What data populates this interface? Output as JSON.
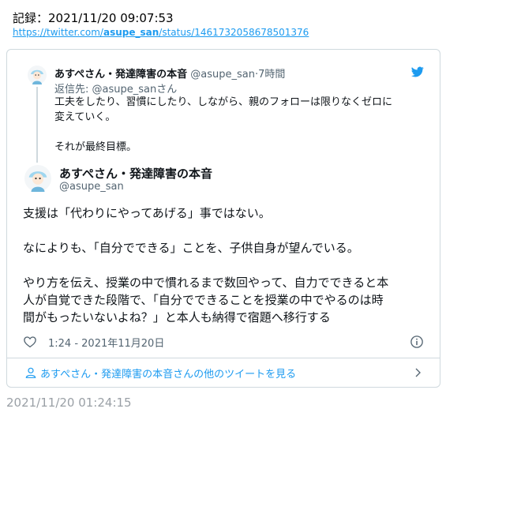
{
  "record": {
    "text": "記録：2021/11/20 09:07:53"
  },
  "source_link": {
    "prefix": "https://twitter.com/",
    "user": "asupe_san",
    "suffix": "/status/1461732058678501376"
  },
  "parent_tweet": {
    "name": "あすぺさん・発達障害の本音",
    "handle": "@asupe_san",
    "separator": "·",
    "time": "7時間",
    "reply_to": "返信先: @asupe_sanさん",
    "text": "工夫をしたり、習慣にしたり、しながら、親のフォローは限りなくゼロに\n変えていく。\n\nそれが最終目標。"
  },
  "main_tweet": {
    "name": "あすぺさん・発達障害の本音",
    "handle": "@asupe_san",
    "text": "支援は「代わりにやってあげる」事ではない。\n\nなによりも、「自分でできる」ことを、子供自身が望んでいる。\n\nやり方を伝え、授業の中で慣れるまで数回やって、自力でできると本\n人が自覚できた段階で、「自分でできることを授業の中でやるのは時\n間がもったいないよね？」と本人も納得で宿題へ移行する",
    "timestamp": "1:24 - 2021年11月20日"
  },
  "more_link": {
    "label": "あすぺさん・発達障害の本音さんの他のツイートを見る"
  },
  "footer": {
    "time": "2021/11/20 01:24:15"
  },
  "icons": [
    "twitter-icon",
    "avatar",
    "heart-icon",
    "info-icon",
    "person-icon",
    "chevron-right-icon"
  ],
  "colors": {
    "accent": "#1d9bf0",
    "muted": "#536471",
    "border": "#cfd9de"
  }
}
